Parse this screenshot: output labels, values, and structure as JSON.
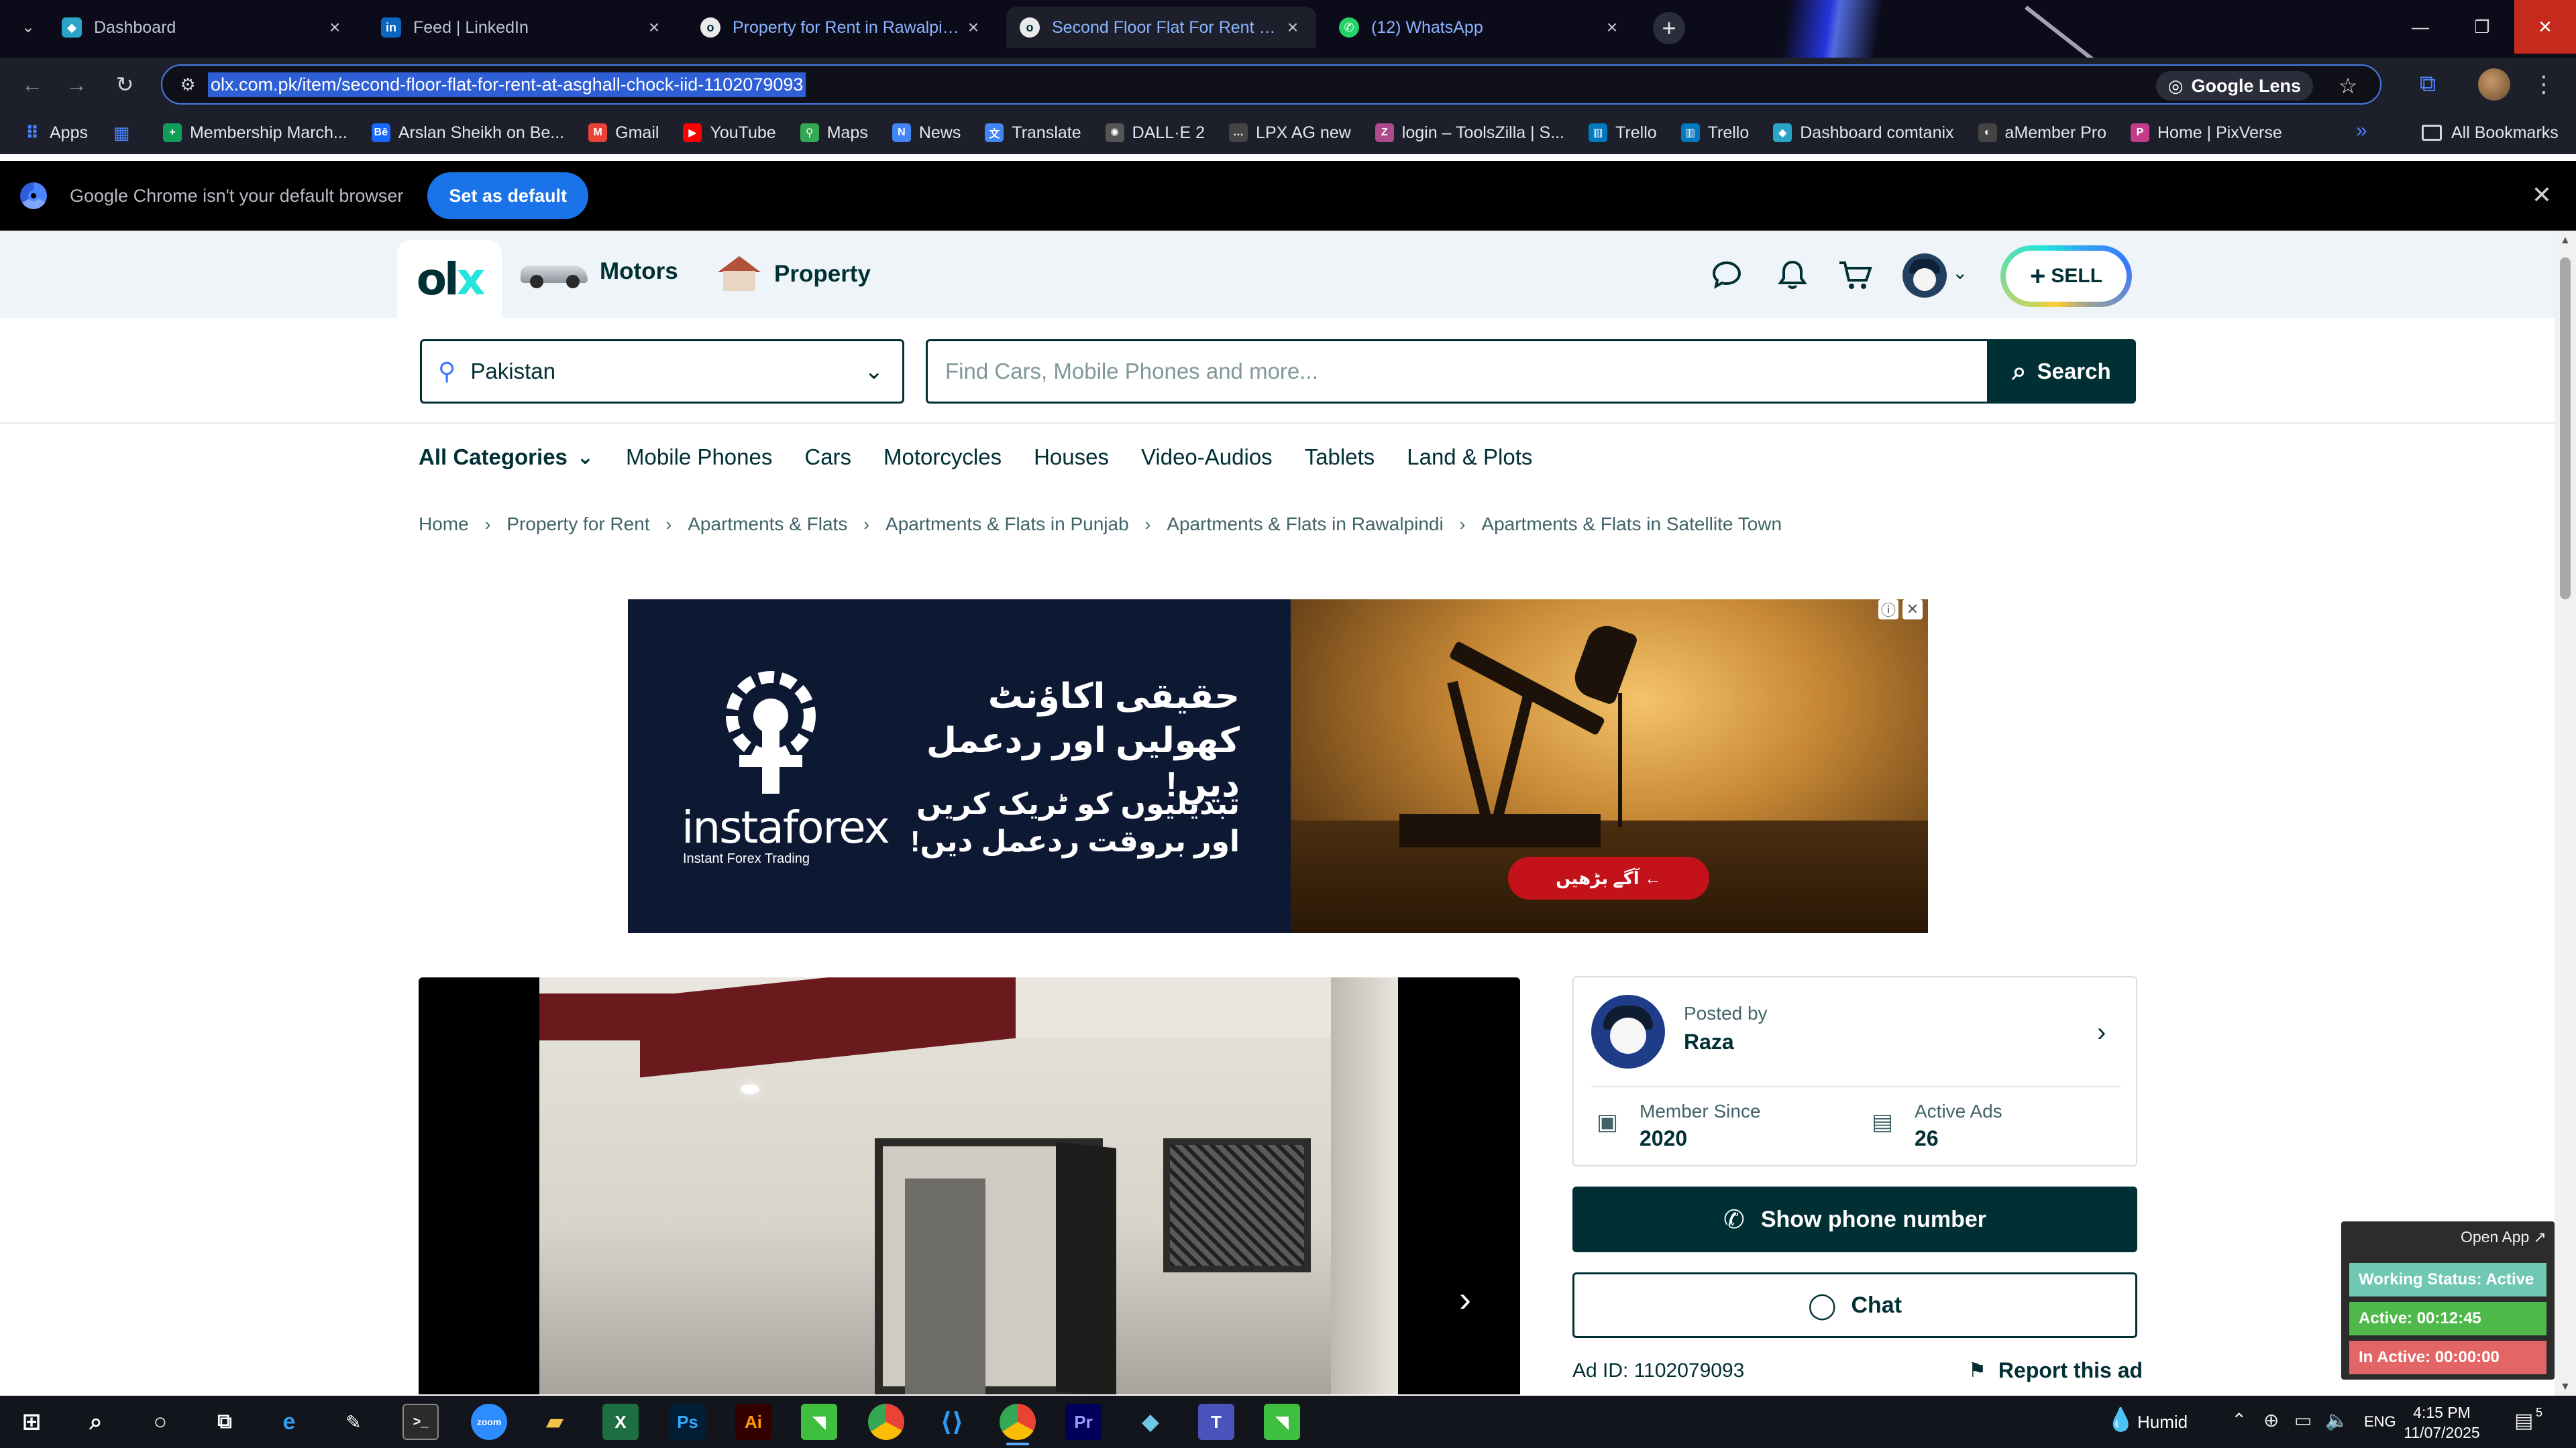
{
  "browser": {
    "tabs": [
      {
        "title": "Dashboard",
        "icon": "dashboard-favicon",
        "color": "#2aa5c8"
      },
      {
        "title": "Feed | LinkedIn",
        "icon": "linkedin-favicon",
        "color": "#0a66c2"
      },
      {
        "title": "Property for Rent in Rawalpindi",
        "icon": "olx-favicon",
        "color": "#3a77ff"
      },
      {
        "title": "Second Floor Flat For Rent at A",
        "icon": "olx-favicon",
        "color": "#3a77ff"
      },
      {
        "title": "(12) WhatsApp",
        "icon": "whatsapp-favicon",
        "color": "#25d366"
      }
    ],
    "url": "olx.com.pk/item/second-floor-flat-for-rent-at-asghall-chock-iid-1102079093",
    "lens_label": "Google Lens",
    "bookmarks": [
      {
        "label": "Apps",
        "icon": "apps-grid-icon",
        "color": "#4b84ff"
      },
      {
        "label": "",
        "icon": "grid-icon",
        "color": "#4b84ff"
      },
      {
        "label": "Membership March...",
        "icon": "spreadsheet-icon",
        "color": "#0f9d58"
      },
      {
        "label": "Arslan Sheikh on Be...",
        "icon": "behance-icon",
        "color": "#1769ff"
      },
      {
        "label": "Gmail",
        "icon": "gmail-icon",
        "color": "#ea4335"
      },
      {
        "label": "YouTube",
        "icon": "youtube-icon",
        "color": "#ff0000"
      },
      {
        "label": "Maps",
        "icon": "maps-pin-icon",
        "color": "#34a853"
      },
      {
        "label": "News",
        "icon": "news-icon",
        "color": "#4285f4"
      },
      {
        "label": "Translate",
        "icon": "translate-icon",
        "color": "#4285f4"
      },
      {
        "label": "DALL·E 2",
        "icon": "openai-icon",
        "color": "#555555"
      },
      {
        "label": "LPX AG new",
        "icon": "dots-icon",
        "color": "#444444"
      },
      {
        "label": "login – ToolsZilla | S...",
        "icon": "toolszilla-icon",
        "color": "#b04a8e"
      },
      {
        "label": "Trello",
        "icon": "trello-icon",
        "color": "#0079bf"
      },
      {
        "label": "Trello",
        "icon": "trello-icon",
        "color": "#0079bf"
      },
      {
        "label": "Dashboard comtanix",
        "icon": "comtanix-icon",
        "color": "#2aa5c8"
      },
      {
        "label": "aMember Pro",
        "icon": "amember-icon",
        "color": "#444444"
      },
      {
        "label": "Home | PixVerse",
        "icon": "pixverse-icon",
        "color": "#c43b8a"
      }
    ],
    "all_bookmarks": "All Bookmarks",
    "infobar_message": "Google Chrome isn't your default browser",
    "infobar_button": "Set as default"
  },
  "olx": {
    "logo": {
      "main": "ol",
      "accent": "x"
    },
    "nav": {
      "motors": "Motors",
      "property": "Property"
    },
    "sell_label": "SELL",
    "location": "Pakistan",
    "search_placeholder": "Find Cars, Mobile Phones and more...",
    "search_button": "Search",
    "all_categories": "All Categories",
    "categories": [
      "Mobile Phones",
      "Cars",
      "Motorcycles",
      "Houses",
      "Video-Audios",
      "Tablets",
      "Land & Plots"
    ],
    "breadcrumb": [
      "Home",
      "Property for Rent",
      "Apartments & Flats",
      "Apartments & Flats in Punjab",
      "Apartments & Flats in Rawalpindi",
      "Apartments & Flats in Satellite Town"
    ],
    "ad_banner": {
      "brand": "instaforex",
      "tagline": "Instant Forex Trading",
      "headline": "حقیقی اکاؤنٹ کھولیں اور ردعمل دیں!",
      "subline": "تبدیلیوں کو ٹریک کریں اور بروقت ردعمل دیں!",
      "cta": "آگے بڑھیں ←"
    },
    "seller": {
      "posted_by_label": "Posted by",
      "name": "Raza",
      "member_since_label": "Member Since",
      "member_since": "2020",
      "active_ads_label": "Active Ads",
      "active_ads": "26"
    },
    "show_phone": "Show phone number",
    "chat": "Chat",
    "ad_id": "Ad ID: 1102079093",
    "report": "Report this ad"
  },
  "tracker": {
    "open_app": "Open App ↗",
    "working_status": "Working Status: Active",
    "active": "Active: 00:12:45",
    "inactive": "In Active: 00:00:00"
  },
  "taskbar": {
    "weather": "Humid",
    "language": "ENG",
    "time": "4:15 PM",
    "date": "11/07/2025",
    "notifications": "5"
  }
}
